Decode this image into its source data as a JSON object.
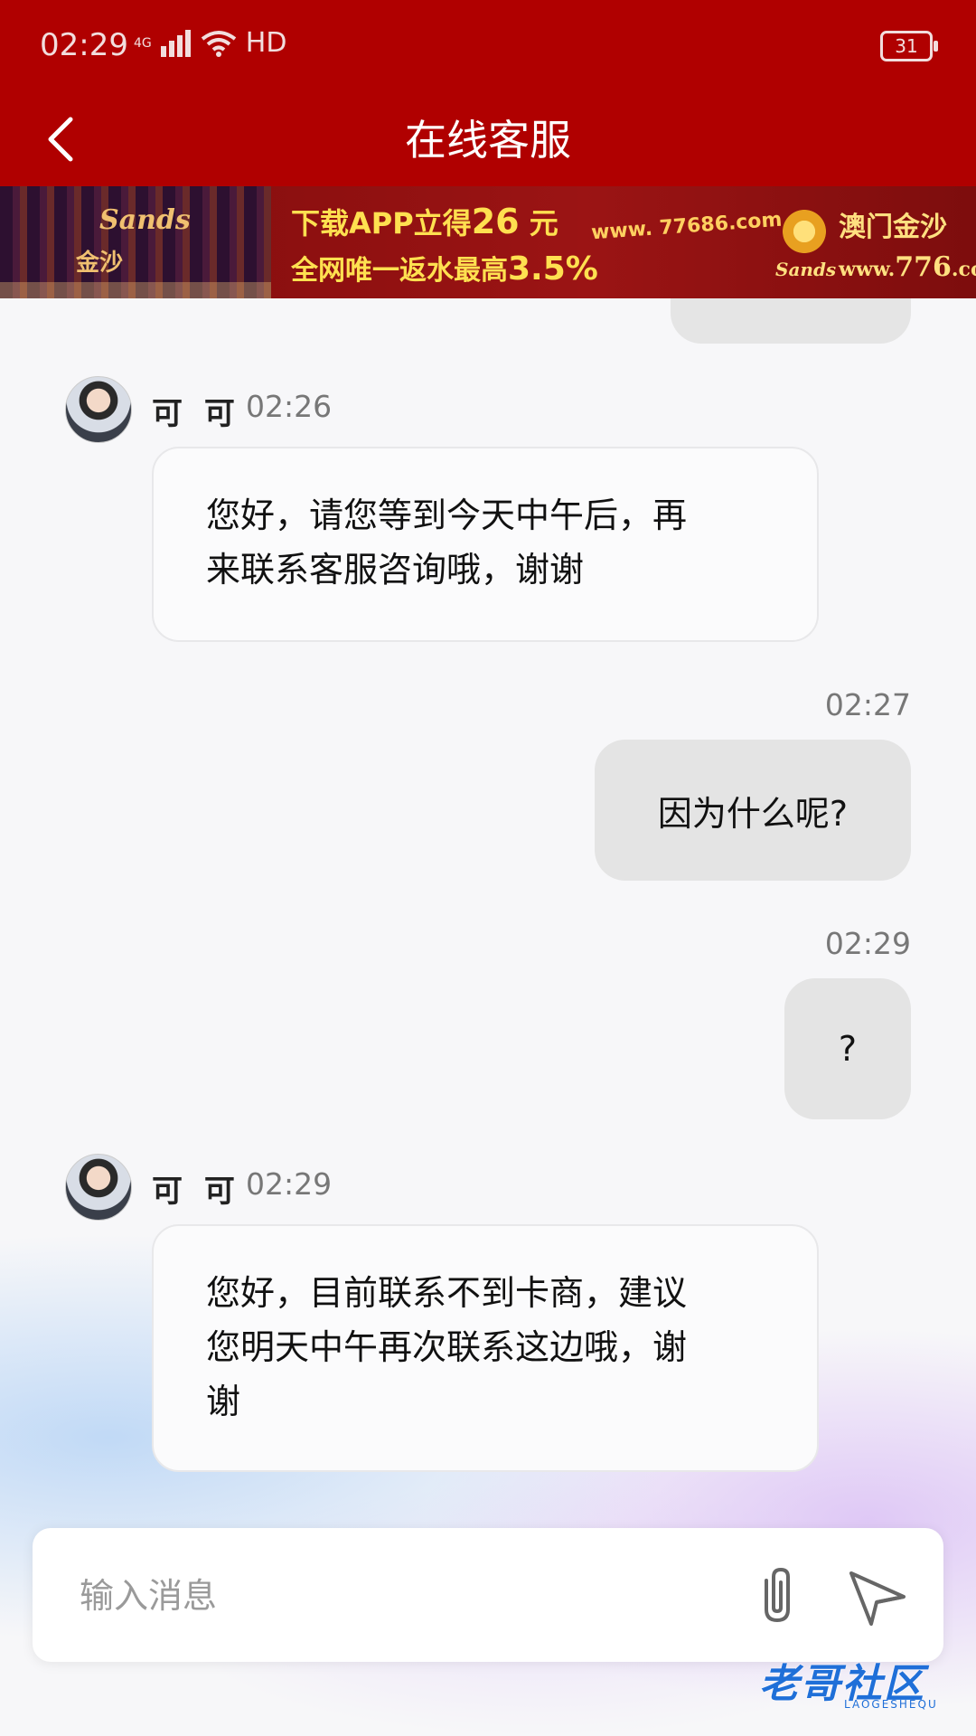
{
  "status_bar": {
    "time": "02:29",
    "network": "4G",
    "hd": "HD",
    "battery": "31"
  },
  "header": {
    "title": "在线客服"
  },
  "banner": {
    "brand_en": "Sands",
    "brand_cn": "金沙",
    "line1_prefix": "下载APP立得",
    "line1_amount": "26",
    "line1_suffix": " 元",
    "line2_prefix": "全网唯一返水最高",
    "line2_rate": "3.5%",
    "url1": "www. 77686.com",
    "brand2_en": "Sands",
    "brand2_cn": "澳门金沙",
    "url2_prefix": "www.",
    "url2_num": "776",
    "url2_suffix": ".com"
  },
  "messages": [
    {
      "sender": "可 可",
      "time": "02:26",
      "text_line1": "您好，请您等到今天中午后，再",
      "text_line2": "来联系客服咨询哦，谢谢"
    },
    {
      "time": "02:27",
      "text": "因为什么呢?"
    },
    {
      "time": "02:29",
      "text": "?"
    },
    {
      "sender": "可 可",
      "time": "02:29",
      "text_line1": "您好，目前联系不到卡商，建议",
      "text_line2": "您明天中午再次联系这边哦，谢",
      "text_line3": "谢"
    }
  ],
  "input": {
    "placeholder": "输入消息",
    "value": ""
  },
  "watermark": {
    "text": "老哥社区",
    "sub": "LAOGESHEQU"
  },
  "colors": {
    "header_red": "#b00000",
    "outgoing_bubble": "#e4e4e4",
    "incoming_bubble": "#fbfbfc"
  }
}
